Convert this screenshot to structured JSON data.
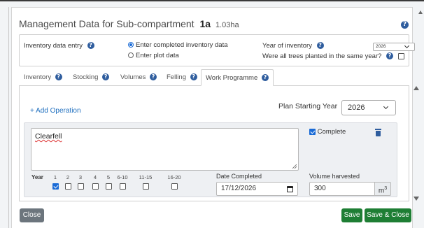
{
  "modal": {
    "title_prefix": "Management Data for Sub-compartment",
    "compartment": "1a",
    "area": "1.03ha"
  },
  "inventory_entry": {
    "label": "Inventory data entry",
    "options": [
      "Enter completed inventory data",
      "Enter plot data"
    ],
    "selected": "Enter completed inventory data",
    "year_label": "Year of inventory",
    "year_value": "2026",
    "same_year_label": "Were all trees planted in the same year?",
    "same_year_checked": false
  },
  "tabs": [
    {
      "label": "Inventory",
      "active": false
    },
    {
      "label": "Stocking",
      "active": false
    },
    {
      "label": "Volumes",
      "active": false
    },
    {
      "label": "Felling",
      "active": false
    },
    {
      "label": "Work Programme",
      "active": true
    }
  ],
  "work_programme": {
    "add_operation_label": "+ Add Operation",
    "plan_start_label": "Plan Starting Year",
    "plan_start_value": "2026",
    "operation": {
      "description": "Clearfell",
      "complete_label": "Complete",
      "complete_checked": true,
      "year_label": "Year",
      "years": [
        {
          "label": "1",
          "checked": true
        },
        {
          "label": "2",
          "checked": false
        },
        {
          "label": "3",
          "checked": false
        },
        {
          "label": "4",
          "checked": false
        },
        {
          "label": "5",
          "checked": false
        },
        {
          "label": "6-10",
          "checked": false
        },
        {
          "label": "11-15",
          "checked": false
        },
        {
          "label": "16-20",
          "checked": false
        }
      ],
      "date_completed_label": "Date Completed",
      "date_completed_value": "17/12/2026",
      "volume_label": "Volume harvested",
      "volume_value": "300",
      "volume_unit": "m",
      "volume_unit_sup": "3"
    }
  },
  "footer": {
    "close_label": "Close",
    "save_label": "Save",
    "save_close_label": "Save & Close"
  },
  "colors": {
    "accent_blue": "#2f5d9e",
    "link_blue": "#1f6fbf",
    "save_green": "#1e7e34",
    "close_gray": "#6c757d"
  }
}
